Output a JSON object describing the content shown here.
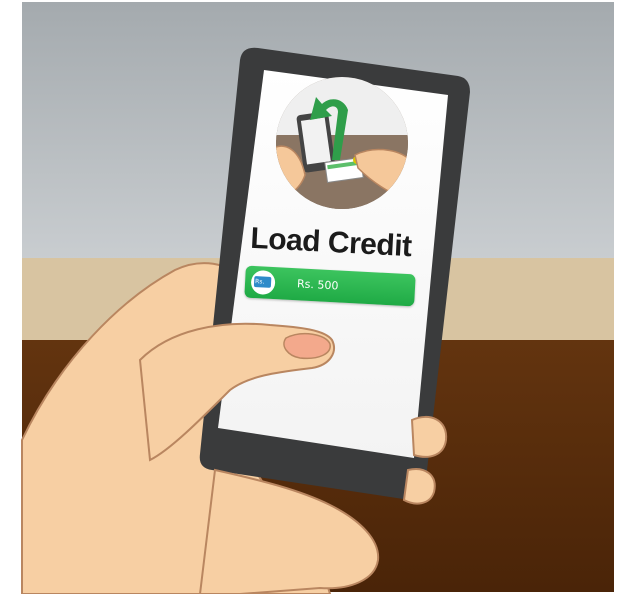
{
  "screen": {
    "title": "Load Credit",
    "button": {
      "label": "Rs. 500",
      "icon": "rupee-note-icon",
      "icon_text": "Rs.",
      "color": "#2db552"
    }
  },
  "illustration": {
    "icon": "phone-and-card-illustration",
    "arrow_color": "#2f9e4a"
  },
  "colors": {
    "wall": "#b9bec2",
    "counter_top": "#d6c2a0",
    "counter_front": "#5a2e0f",
    "phone_body": "#3a3b3c",
    "skin": "#f7cfa3"
  }
}
